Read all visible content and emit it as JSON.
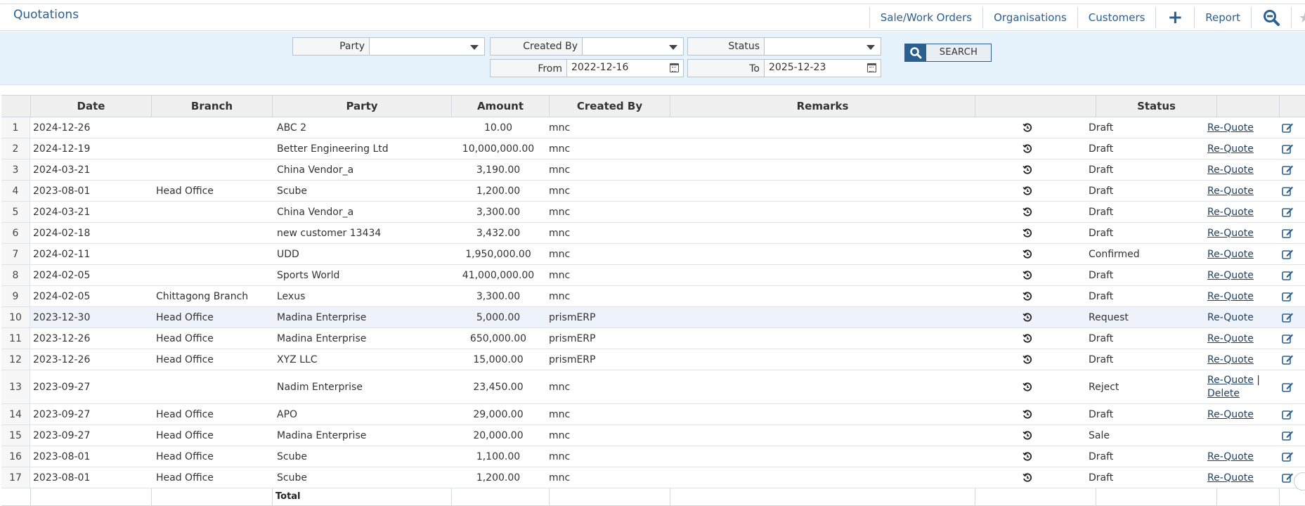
{
  "header": {
    "title": "Quotations",
    "nav": {
      "sale_work_orders": "Sale/Work Orders",
      "organisations": "Organisations",
      "customers": "Customers",
      "report": "Report"
    }
  },
  "filters": {
    "party_label": "Party",
    "party_value": "",
    "created_by_label": "Created By",
    "created_by_value": "",
    "status_label": "Status",
    "status_value": "",
    "from_label": "From",
    "from_value": "2022-12-16",
    "to_label": "To",
    "to_value": "2025-12-23",
    "search_label": "SEARCH"
  },
  "table": {
    "headers": {
      "num": "",
      "date": "Date",
      "branch": "Branch",
      "party": "Party",
      "amount": "Amount",
      "created_by": "Created By",
      "remarks": "Remarks",
      "history": "",
      "status": "Status",
      "action": "",
      "edit": ""
    },
    "rows": [
      {
        "n": "1",
        "date": "2024-12-26",
        "branch": "",
        "party": "ABC 2",
        "amount": "10.00",
        "created_by": "mnc",
        "remarks": "",
        "status": "Draft",
        "action": "Re-Quote",
        "action2": ""
      },
      {
        "n": "2",
        "date": "2024-12-19",
        "branch": "",
        "party": "Better Engineering Ltd",
        "amount": "10,000,000.00",
        "created_by": "mnc",
        "remarks": "",
        "status": "Draft",
        "action": "Re-Quote",
        "action2": ""
      },
      {
        "n": "3",
        "date": "2024-03-21",
        "branch": "",
        "party": "China Vendor_a",
        "amount": "3,190.00",
        "created_by": "mnc",
        "remarks": "",
        "status": "Draft",
        "action": "Re-Quote",
        "action2": ""
      },
      {
        "n": "4",
        "date": "2023-08-01",
        "branch": "Head Office",
        "party": "Scube",
        "amount": "1,200.00",
        "created_by": "mnc",
        "remarks": "",
        "status": "Draft",
        "action": "Re-Quote",
        "action2": ""
      },
      {
        "n": "5",
        "date": "2024-03-21",
        "branch": "",
        "party": "China Vendor_a",
        "amount": "3,300.00",
        "created_by": "mnc",
        "remarks": "",
        "status": "Draft",
        "action": "Re-Quote",
        "action2": ""
      },
      {
        "n": "6",
        "date": "2024-02-18",
        "branch": "",
        "party": "new customer 13434",
        "amount": "3,432.00",
        "created_by": "mnc",
        "remarks": "",
        "status": "Draft",
        "action": "Re-Quote",
        "action2": ""
      },
      {
        "n": "7",
        "date": "2024-02-11",
        "branch": "",
        "party": "UDD",
        "amount": "1,950,000.00",
        "created_by": "mnc",
        "remarks": "",
        "status": "Confirmed",
        "action": "Re-Quote",
        "action2": ""
      },
      {
        "n": "8",
        "date": "2024-02-05",
        "branch": "",
        "party": "Sports World",
        "amount": "41,000,000.00",
        "created_by": "mnc",
        "remarks": "",
        "status": "Draft",
        "action": "Re-Quote",
        "action2": ""
      },
      {
        "n": "9",
        "date": "2024-02-05",
        "branch": "Chittagong Branch",
        "party": "Lexus",
        "amount": "3,300.00",
        "created_by": "mnc",
        "remarks": "",
        "status": "Draft",
        "action": "Re-Quote",
        "action2": ""
      },
      {
        "n": "10",
        "date": "2023-12-30",
        "branch": "Head Office",
        "party": "Madina Enterprise",
        "amount": "5,000.00",
        "created_by": "prismERP",
        "remarks": "",
        "status": "Request",
        "action": "Re-Quote",
        "action2": ""
      },
      {
        "n": "11",
        "date": "2023-12-26",
        "branch": "Head Office",
        "party": "Madina Enterprise",
        "amount": "650,000.00",
        "created_by": "prismERP",
        "remarks": "",
        "status": "Draft",
        "action": "Re-Quote",
        "action2": ""
      },
      {
        "n": "12",
        "date": "2023-12-26",
        "branch": "Head Office",
        "party": "XYZ LLC",
        "amount": "15,000.00",
        "created_by": "prismERP",
        "remarks": "",
        "status": "Draft",
        "action": "Re-Quote",
        "action2": ""
      },
      {
        "n": "13",
        "date": "2023-09-27",
        "branch": "",
        "party": "Nadim Enterprise",
        "amount": "23,450.00",
        "created_by": "mnc",
        "remarks": "",
        "status": "Reject",
        "action": "Re-Quote",
        "action2": "Delete"
      },
      {
        "n": "14",
        "date": "2023-09-27",
        "branch": "Head Office",
        "party": "APO",
        "amount": "29,000.00",
        "created_by": "mnc",
        "remarks": "",
        "status": "Draft",
        "action": "Re-Quote",
        "action2": ""
      },
      {
        "n": "15",
        "date": "2023-09-27",
        "branch": "Head Office",
        "party": "Madina Enterprise",
        "amount": "20,000.00",
        "created_by": "mnc",
        "remarks": "",
        "status": "Sale",
        "action": "",
        "action2": ""
      },
      {
        "n": "16",
        "date": "2023-08-01",
        "branch": "Head Office",
        "party": "Scube",
        "amount": "1,100.00",
        "created_by": "mnc",
        "remarks": "",
        "status": "Draft",
        "action": "Re-Quote",
        "action2": ""
      },
      {
        "n": "17",
        "date": "2023-08-01",
        "branch": "Head Office",
        "party": "Scube",
        "amount": "1,200.00",
        "created_by": "mnc",
        "remarks": "",
        "status": "Draft",
        "action": "Re-Quote",
        "action2": ""
      }
    ],
    "footer": {
      "total_label": "Total"
    }
  },
  "colors": {
    "accent": "#2a5f8f",
    "filter_bg": "#e6f3fc",
    "highlight_row": "#eef2fb"
  }
}
